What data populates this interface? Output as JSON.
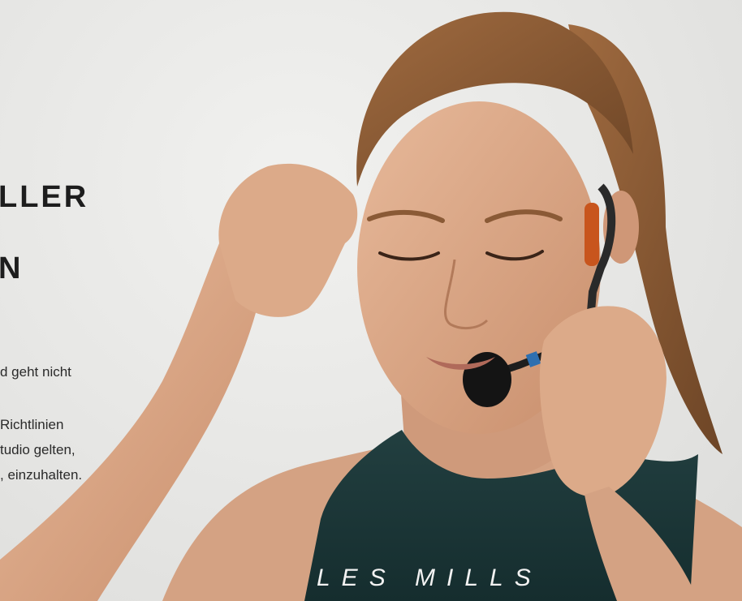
{
  "hero": {
    "headline_line1": "LLER",
    "headline_line2": "N",
    "paragraph1_line1": "d geht nicht",
    "paragraph2_line1": "Richtlinien",
    "paragraph2_line2": "tudio gelten,",
    "paragraph2_line3": ", einzuhalten."
  },
  "image": {
    "description_icon": "instructor-photo",
    "shirt_print": "LES MILLS"
  },
  "colors": {
    "background": "#e6e6e4",
    "shirt": "#1c3a3b",
    "skin": "#d9a98a",
    "hair": "#8a5a36",
    "text": "#1d1d1d"
  }
}
